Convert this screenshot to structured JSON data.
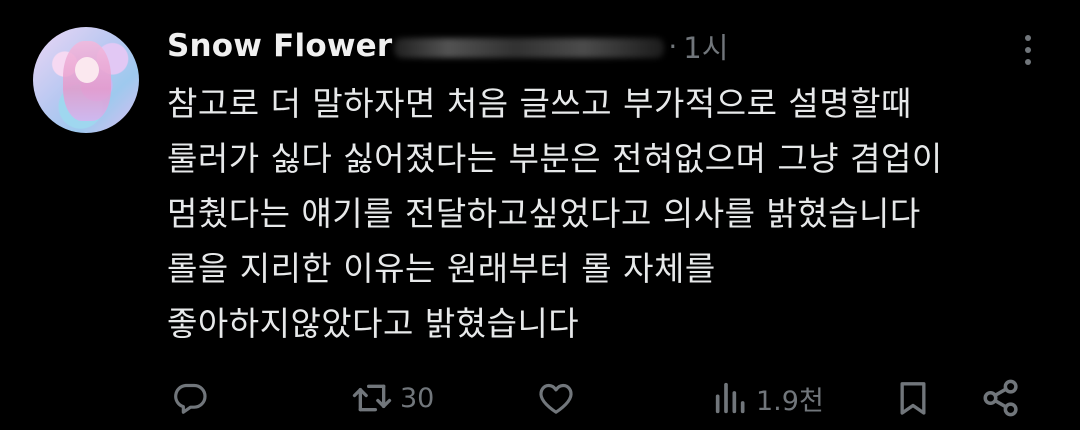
{
  "post": {
    "author_name": "Snow Flower",
    "separator": "·",
    "time": "1시",
    "text_lines": [
      "참고로 더 말하자면 처음 글쓰고 부가적으로 설명할때",
      "룰러가 싫다 싫어졌다는 부분은 전혀없으며 그냥 겸업이",
      "멈췄다는 얘기를 전달하고싶었다고 의사를 밝혔습니다",
      "롤을 지리한 이유는 원래부터 롤 자체를",
      "좋아하지않았다고 밝혔습니다"
    ]
  },
  "actions": {
    "reply_icon": "reply-icon",
    "repost_icon": "repost-icon",
    "repost_count": "30",
    "like_icon": "heart-icon",
    "views_icon": "views-icon",
    "views_count": "1.9천",
    "bookmark_icon": "bookmark-icon",
    "share_icon": "share-icon"
  },
  "colors": {
    "background": "#000000",
    "text": "#e7e9ea",
    "secondary": "#71767b"
  }
}
